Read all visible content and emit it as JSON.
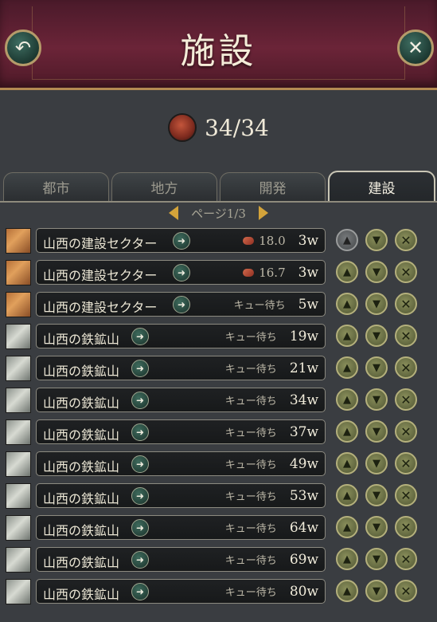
{
  "header": {
    "title": "施設"
  },
  "resource": {
    "value": "34/34"
  },
  "tabs": [
    {
      "label": "都市"
    },
    {
      "label": "地方"
    },
    {
      "label": "開発"
    },
    {
      "label": "建設"
    }
  ],
  "pager": {
    "label": "ページ1/3"
  },
  "rows": [
    {
      "type": "sector",
      "name": "山西の建設セクター",
      "status": "18.0",
      "weeks": "3w"
    },
    {
      "type": "sector",
      "name": "山西の建設セクター",
      "status": "16.7",
      "weeks": "3w"
    },
    {
      "type": "sector",
      "name": "山西の建設セクター",
      "status": "キュー待ち",
      "weeks": "5w"
    },
    {
      "type": "mine",
      "name": "山西の鉄鉱山",
      "status": "キュー待ち",
      "weeks": "19w"
    },
    {
      "type": "mine",
      "name": "山西の鉄鉱山",
      "status": "キュー待ち",
      "weeks": "21w"
    },
    {
      "type": "mine",
      "name": "山西の鉄鉱山",
      "status": "キュー待ち",
      "weeks": "34w"
    },
    {
      "type": "mine",
      "name": "山西の鉄鉱山",
      "status": "キュー待ち",
      "weeks": "37w"
    },
    {
      "type": "mine",
      "name": "山西の鉄鉱山",
      "status": "キュー待ち",
      "weeks": "49w"
    },
    {
      "type": "mine",
      "name": "山西の鉄鉱山",
      "status": "キュー待ち",
      "weeks": "53w"
    },
    {
      "type": "mine",
      "name": "山西の鉄鉱山",
      "status": "キュー待ち",
      "weeks": "64w"
    },
    {
      "type": "mine",
      "name": "山西の鉄鉱山",
      "status": "キュー待ち",
      "weeks": "69w"
    },
    {
      "type": "mine",
      "name": "山西の鉄鉱山",
      "status": "キュー待ち",
      "weeks": "80w"
    }
  ],
  "icons": {
    "back": "back-arrow-icon",
    "close": "close-icon",
    "resource": "construction-resource-icon",
    "go": "arrow-right-icon",
    "up": "priority-up-icon",
    "down": "priority-down-icon",
    "delete": "remove-icon"
  },
  "colors": {
    "accent_gold": "#d3a33a",
    "header_maroon": "#6b2438",
    "panel_bg": "#3a3d41"
  }
}
